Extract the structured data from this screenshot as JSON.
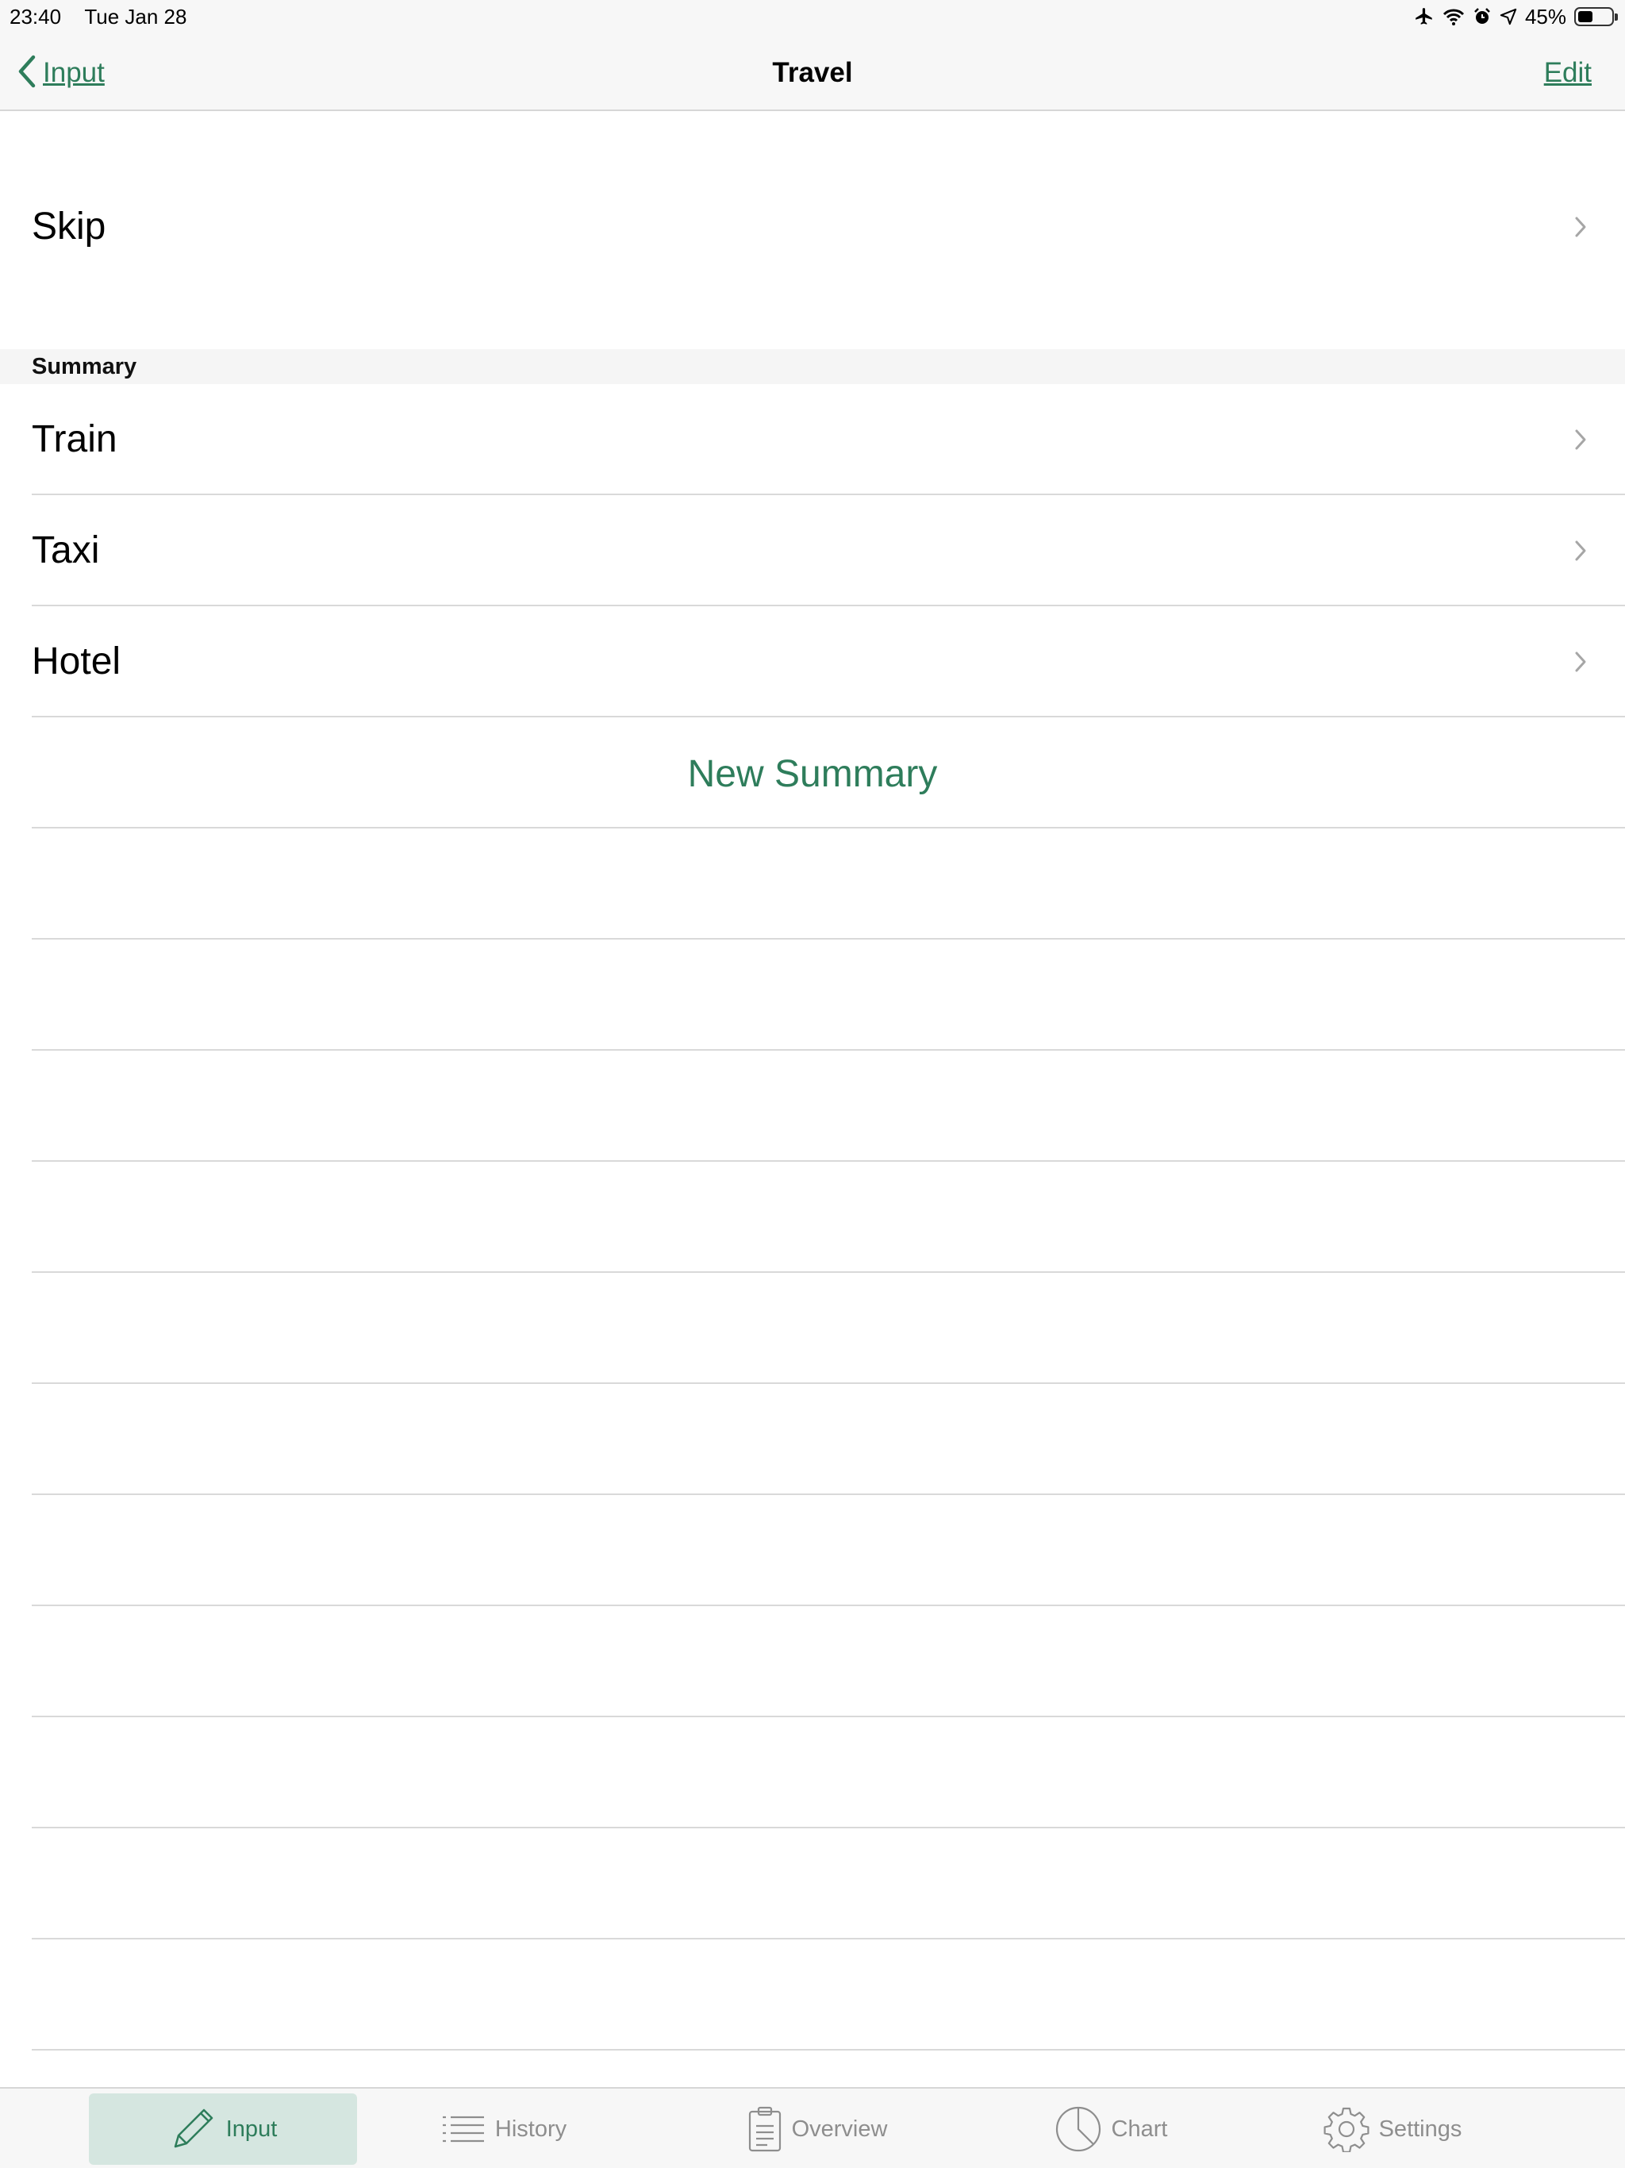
{
  "status_bar": {
    "time": "23:40",
    "date": "Tue Jan 28",
    "battery_text": "45%",
    "battery_level": 0.45
  },
  "nav": {
    "back_label": "Input",
    "title": "Travel",
    "edit_label": "Edit"
  },
  "list": {
    "skip_label": "Skip",
    "section_header": "Summary",
    "items": [
      {
        "label": "Train"
      },
      {
        "label": "Taxi"
      },
      {
        "label": "Hotel"
      }
    ],
    "new_summary_label": "New Summary"
  },
  "tabs": [
    {
      "label": "Input",
      "icon": "pencil-icon",
      "active": true
    },
    {
      "label": "History",
      "icon": "list-icon",
      "active": false
    },
    {
      "label": "Overview",
      "icon": "clipboard-icon",
      "active": false
    },
    {
      "label": "Chart",
      "icon": "pie-chart-icon",
      "active": false
    },
    {
      "label": "Settings",
      "icon": "gear-icon",
      "active": false
    }
  ],
  "colors": {
    "accent": "#2e7d5b",
    "active_tab_background": "#d5e6e0",
    "separator": "#d9d9d9"
  }
}
